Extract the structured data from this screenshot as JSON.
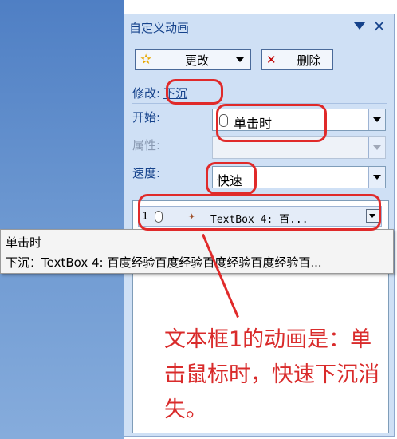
{
  "pane": {
    "title": "自定义动画",
    "change_label": "更改",
    "delete_label": "删除",
    "modify_label": "修改:",
    "modify_value": "下沉",
    "start_label": "开始:",
    "start_value": "单击时",
    "property_label": "属性:",
    "property_value": "",
    "speed_label": "速度:",
    "speed_value": "快速"
  },
  "animation_list": {
    "items": [
      {
        "index": "1",
        "text": "TextBox 4: 百..."
      }
    ]
  },
  "tooltip": {
    "line1": "单击时",
    "line2": "下沉：TextBox 4: 百度经验百度经验百度经验百度经验百..."
  },
  "annotation": {
    "text": "文本框1的动画是：单击鼠标时，快速下沉消失。"
  },
  "icons": {
    "menu": "dropdown-triangle-icon",
    "close": "close-icon",
    "change": "star-icon",
    "delete": "delete-x-icon",
    "start": "mouse-icon",
    "effect": "effect-star-icon"
  },
  "colors": {
    "pane_bg": "#cfe0f5",
    "title_text": "#15428b",
    "annotation_red": "#d92b2b"
  }
}
